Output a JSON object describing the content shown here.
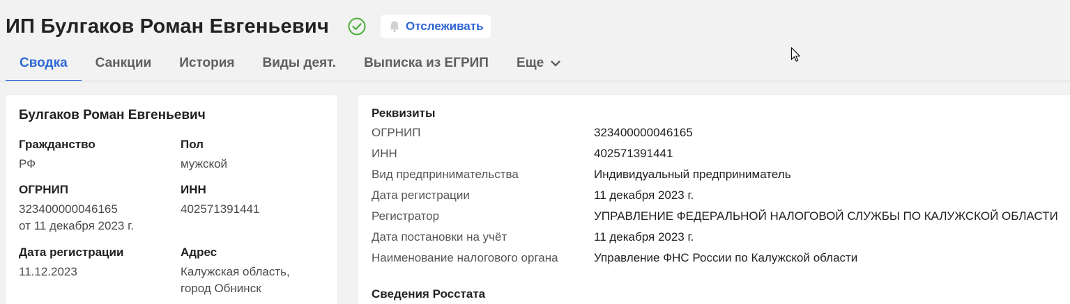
{
  "header": {
    "title": "ИП Булгаков Роман Евгеньевич",
    "track_label": "Отслеживать",
    "icons": {
      "verified": "check-circle-icon",
      "bell": "bell-icon"
    },
    "colors": {
      "verified": "#4caf3a",
      "accent": "#2e6ad8"
    }
  },
  "tabs": [
    {
      "label": "Сводка",
      "active": true
    },
    {
      "label": "Санкции"
    },
    {
      "label": "История"
    },
    {
      "label": "Виды деят."
    },
    {
      "label": "Выписка из ЕГРИП"
    },
    {
      "label": "Еще"
    }
  ],
  "summary": {
    "name": "Булгаков Роман Евгеньевич",
    "citizenship_label": "Гражданство",
    "citizenship_value": "РФ",
    "gender_label": "Пол",
    "gender_value": "мужской",
    "ogrnip_label": "ОГРНИП",
    "ogrnip_value": "323400000046165",
    "ogrnip_date": "от 11 декабря 2023 г.",
    "inn_label": "ИНН",
    "inn_value": "402571391441",
    "regdate_label": "Дата регистрации",
    "regdate_value": "11.12.2023",
    "address_label": "Адрес",
    "address_line1": "Калужская область,",
    "address_line2": "город Обнинск"
  },
  "requisites": {
    "title": "Реквизиты",
    "rows": [
      {
        "label": "ОГРНИП",
        "value": "323400000046165"
      },
      {
        "label": "ИНН",
        "value": "402571391441"
      },
      {
        "label": "Вид предпринимательства",
        "value": "Индивидуальный предприниматель"
      },
      {
        "label": "Дата регистрации",
        "value": "11 декабря 2023 г."
      },
      {
        "label": "Регистратор",
        "value": "УПРАВЛЕНИЕ ФЕДЕРАЛЬНОЙ НАЛОГОВОЙ СЛУЖБЫ ПО КАЛУЖСКОЙ ОБЛАСТИ"
      },
      {
        "label": "Дата постановки на учёт",
        "value": "11 декабря 2023 г."
      },
      {
        "label": "Наименование налогового органа",
        "value": "Управление ФНС России по Калужской области"
      }
    ]
  },
  "rosstat": {
    "title": "Сведения Росстата"
  }
}
